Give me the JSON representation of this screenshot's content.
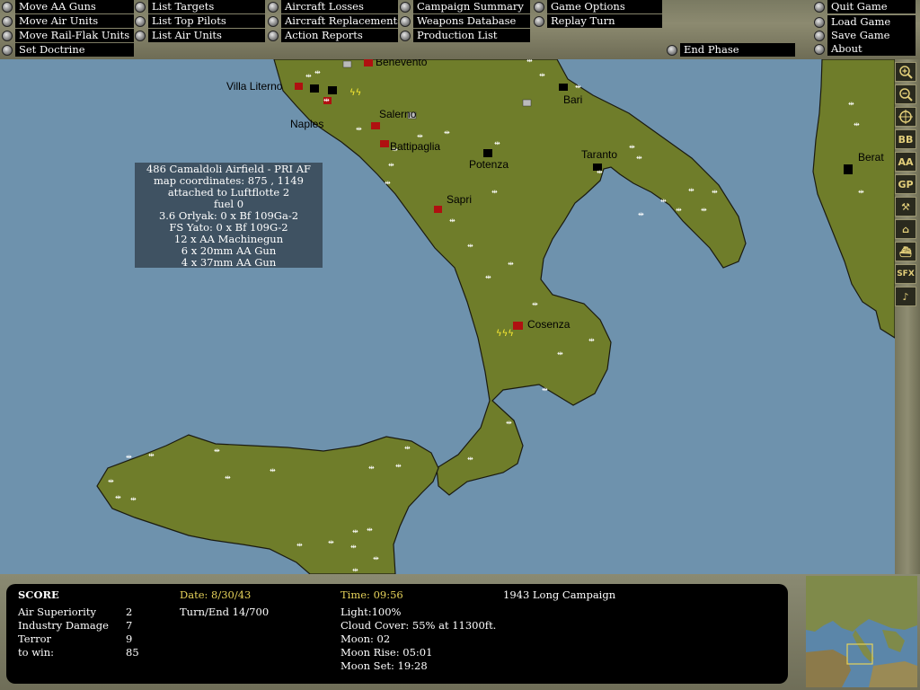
{
  "menu": {
    "col1": [
      "Move AA Guns",
      "Move Air Units",
      "Move Rail-Flak Units",
      "Set Doctrine"
    ],
    "col2": [
      "List Targets",
      "List Top Pilots",
      "List Air Units"
    ],
    "col3": [
      "Aircraft Losses",
      "Aircraft Replacements",
      "Action Reports"
    ],
    "col4": [
      "Campaign Summary",
      "Weapons Database",
      "Production List"
    ],
    "col5": [
      "Game Options",
      "Replay Turn"
    ],
    "end_phase": "End Phase",
    "right": [
      "Quit Game",
      "Load Game",
      "Save Game",
      "About"
    ]
  },
  "map": {
    "cities": [
      "Benevento",
      "Villa Literno",
      "Naples",
      "Salerno",
      "Bari",
      "Battipaglia",
      "Potenza",
      "Taranto",
      "Sapri",
      "Cosenza",
      "Berat"
    ]
  },
  "tooltip": {
    "lines": [
      "486 Camaldoli Airfield - PRI AF",
      "map coordinates: 875 , 1149",
      "attached to Luftflotte 2",
      "fuel 0",
      "3.6 Orlyak:  0 x Bf 109Ga-2",
      "FS Yato:  0 x Bf 109G-2",
      "12 x AA Machinegun",
      "6 x 20mm AA Gun",
      "4 x 37mm AA Gun"
    ]
  },
  "toolbar": {
    "buttons": [
      "zoom-in",
      "zoom-out",
      "center",
      "BB",
      "AA",
      "GP",
      "tools",
      "buildings",
      "ship",
      "SFX",
      "music"
    ]
  },
  "score": {
    "title": "SCORE",
    "rows": [
      {
        "label": "Air Superiority",
        "value": "2"
      },
      {
        "label": "Industry Damage",
        "value": "7"
      },
      {
        "label": "Terror",
        "value": "9"
      },
      {
        "label": "to win:",
        "value": "85"
      }
    ],
    "date": "Date: 8/30/43",
    "turn": "Turn/End 14/700",
    "time": "Time: 09:56",
    "campaign": "1943 Long Campaign",
    "light": "Light:100%",
    "cloud": "Cloud Cover: 55% at 11300ft.",
    "moon": "Moon: 02",
    "moonrise": "Moon Rise: 05:01",
    "moonset": "Moon Set: 19:28"
  },
  "colors": {
    "sea": "#6e92ad",
    "land": "#6f7d2a",
    "tooltip": "#3f5262",
    "date_yellow": "#e6d25a"
  }
}
